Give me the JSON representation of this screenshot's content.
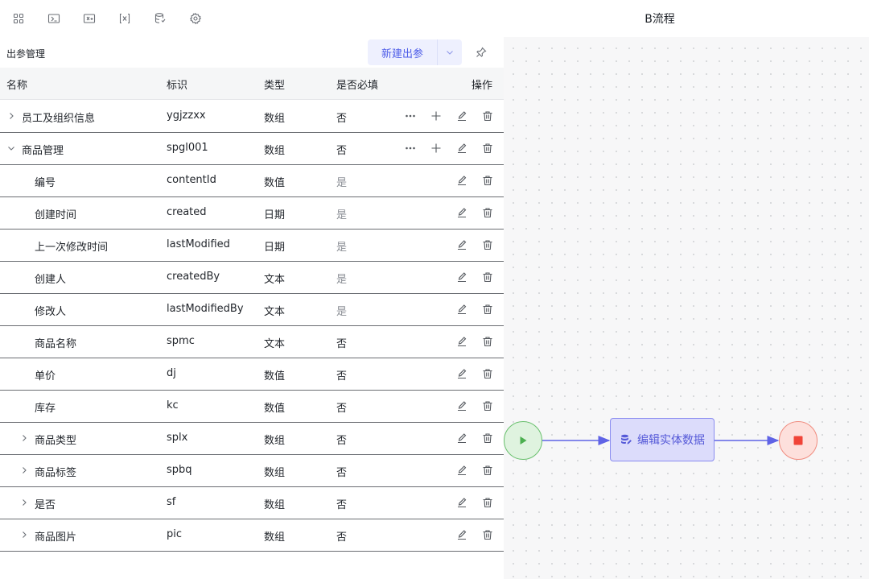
{
  "toolbar": {
    "icons": [
      "grid-icon",
      "variable-in-icon",
      "variable-out-icon",
      "variable-fx-icon",
      "database-icon",
      "gear-icon"
    ]
  },
  "flow": {
    "title": "B流程",
    "task_label": "编辑实体数据",
    "start_color": "#4caf50",
    "end_color": "#f04438",
    "task_color": "#5559d8"
  },
  "panel": {
    "title": "出参管理",
    "new_button": "新建出参"
  },
  "table": {
    "headers": {
      "name": "名称",
      "id": "标识",
      "type": "类型",
      "required": "是否必填",
      "actions": "操作"
    },
    "rows": [
      {
        "name": "员工及组织信息",
        "id": "ygjzzxx",
        "type": "数组",
        "required": "否",
        "level": 0,
        "expandable": "collapsed",
        "more": true
      },
      {
        "name": "商品管理",
        "id": "spgl001",
        "type": "数组",
        "required": "否",
        "level": 0,
        "expandable": "expanded",
        "more": true
      },
      {
        "name": "编号",
        "id": "contentId",
        "type": "数值",
        "required": "是",
        "level": 1,
        "expandable": "none",
        "more": false
      },
      {
        "name": "创建时间",
        "id": "created",
        "type": "日期",
        "required": "是",
        "level": 1,
        "expandable": "none",
        "more": false
      },
      {
        "name": "上一次修改时间",
        "id": "lastModified",
        "type": "日期",
        "required": "是",
        "level": 1,
        "expandable": "none",
        "more": false
      },
      {
        "name": "创建人",
        "id": "createdBy",
        "type": "文本",
        "required": "是",
        "level": 1,
        "expandable": "none",
        "more": false
      },
      {
        "name": "修改人",
        "id": "lastModifiedBy",
        "type": "文本",
        "required": "是",
        "level": 1,
        "expandable": "none",
        "more": false
      },
      {
        "name": "商品名称",
        "id": "spmc",
        "type": "文本",
        "required": "否",
        "level": 1,
        "expandable": "none",
        "more": false
      },
      {
        "name": "单价",
        "id": "dj",
        "type": "数值",
        "required": "否",
        "level": 1,
        "expandable": "none",
        "more": false
      },
      {
        "name": "库存",
        "id": "kc",
        "type": "数值",
        "required": "否",
        "level": 1,
        "expandable": "none",
        "more": false
      },
      {
        "name": "商品类型",
        "id": "splx",
        "type": "数组",
        "required": "否",
        "level": 1,
        "expandable": "collapsed",
        "more": false
      },
      {
        "name": "商品标签",
        "id": "spbq",
        "type": "数组",
        "required": "否",
        "level": 1,
        "expandable": "collapsed",
        "more": false
      },
      {
        "name": "是否",
        "id": "sf",
        "type": "数组",
        "required": "否",
        "level": 1,
        "expandable": "collapsed",
        "more": false
      },
      {
        "name": "商品图片",
        "id": "pic",
        "type": "数组",
        "required": "否",
        "level": 1,
        "expandable": "collapsed",
        "more": false
      }
    ]
  }
}
